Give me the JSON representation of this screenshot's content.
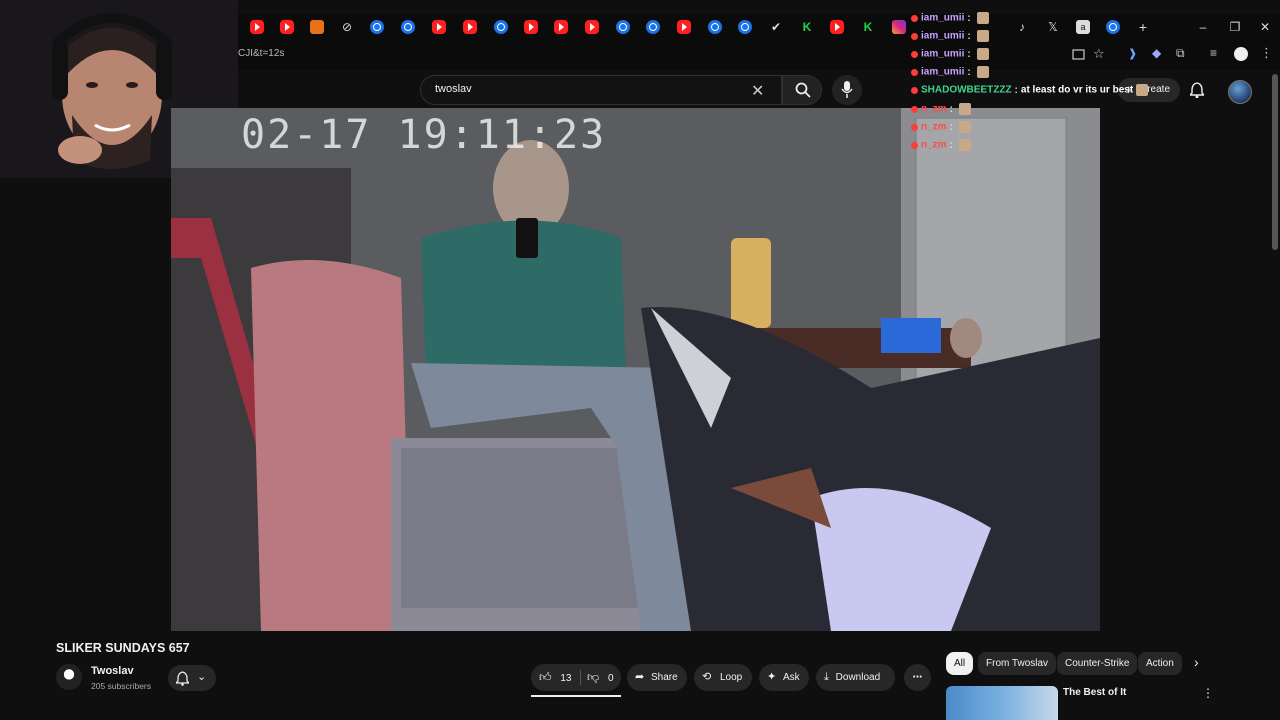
{
  "browser": {
    "url_fragment": "CJI&t=12s",
    "new_tab_label": "+",
    "window_controls": [
      "–",
      "❐",
      "✕"
    ]
  },
  "header": {
    "search_value": "twoslav",
    "create_label": "Create"
  },
  "video": {
    "timestamp": "02-17  19:11:23"
  },
  "chat": {
    "messages": [
      {
        "user": "iam_umii",
        "sep": ":",
        "text": ""
      },
      {
        "user": "iam_umii",
        "sep": ":",
        "text": ""
      },
      {
        "user": "iam_umii",
        "sep": ":",
        "text": ""
      },
      {
        "user": "iam_umii",
        "sep": ":",
        "text": ""
      },
      {
        "user": "SHADOWBEETZZZ",
        "sep": ":",
        "text": "at least do vr its ur best"
      },
      {
        "user": "n_zm",
        "sep": ":",
        "text": ""
      },
      {
        "user": "n_zm",
        "sep": ":",
        "text": ""
      },
      {
        "user": "n_zm",
        "sep": ":",
        "text": ""
      }
    ],
    "colors": {
      "iam": "#c8a0ff",
      "shadow": "#3cd68a",
      "nzm": "#ff4a4a"
    }
  },
  "watch": {
    "title": "SLIKER SUNDAYS 657",
    "channel_name": "Twoslav",
    "subscribers": "205 subscribers",
    "like_count": "13",
    "dislike_count": "0",
    "share_label": "Share",
    "loop_label": "Loop",
    "ask_label": "Ask",
    "download_label": "Download"
  },
  "sidebar": {
    "chips": [
      "All",
      "From Twoslav",
      "Counter-Strike",
      "Action"
    ],
    "rec_title": "The Best of It"
  }
}
